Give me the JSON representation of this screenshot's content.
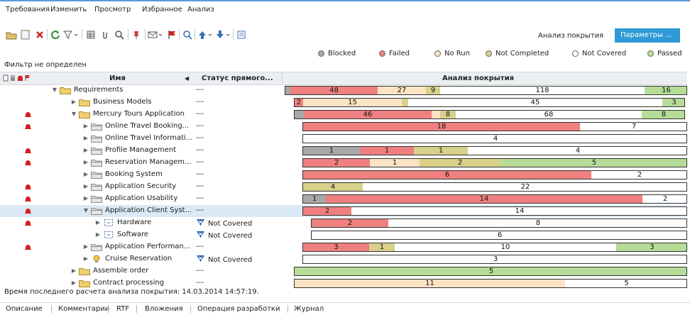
{
  "menu": {
    "items": [
      "Требования",
      "Изменить",
      "Просмотр",
      "Избранное",
      "Анализ"
    ]
  },
  "toolbar": {
    "coverage_label": "Анализ покрытия",
    "params_button": "Параметры ..."
  },
  "legend": [
    {
      "label": "Blocked",
      "color": "#a8a8a8"
    },
    {
      "label": "Failed",
      "color": "#f08080"
    },
    {
      "label": "No Run",
      "color": "#fbe3c4"
    },
    {
      "label": "Not Completed",
      "color": "#d9d08a"
    },
    {
      "label": "Not Covered",
      "color": "#ffffff"
    },
    {
      "label": "Passed",
      "color": "#b7dc98"
    }
  ],
  "filter_text": "Фильтр не определен",
  "columns": {
    "name": "Имя",
    "status": "Статус прямого...",
    "analysis": "Анализ покрытия"
  },
  "rows": [
    {
      "name": "Requirements",
      "status": "---",
      "segs": [
        {
          "s": "blocked",
          "v": ""
        },
        {
          "s": "failed",
          "v": "48"
        },
        {
          "s": "norun",
          "v": "27"
        },
        {
          "s": "notcompleted",
          "v": "9"
        },
        {
          "s": "notcovered",
          "v": "118"
        },
        {
          "s": "passed",
          "v": "16"
        }
      ]
    },
    {
      "name": "Business Models",
      "status": "---",
      "segs": [
        {
          "s": "failed",
          "v": "2"
        },
        {
          "s": "norun",
          "v": "15"
        },
        {
          "s": "notcompleted",
          "v": ""
        },
        {
          "s": "notcovered",
          "v": "45"
        },
        {
          "s": "passed",
          "v": "3"
        }
      ]
    },
    {
      "name": "Mercury Tours Application",
      "status": "---",
      "segs": [
        {
          "s": "blocked",
          "v": ""
        },
        {
          "s": "failed",
          "v": "46"
        },
        {
          "s": "norun",
          "v": ""
        },
        {
          "s": "notcompleted",
          "v": "8"
        },
        {
          "s": "notcovered",
          "v": "68"
        },
        {
          "s": "passed",
          "v": "8"
        }
      ]
    },
    {
      "name": "Online Travel Booking...",
      "status": "---",
      "segs": [
        {
          "s": "failed",
          "v": "18"
        },
        {
          "s": "notcovered",
          "v": "7"
        }
      ]
    },
    {
      "name": "Online Travel Informati...",
      "status": "---",
      "segs": [
        {
          "s": "notcovered",
          "v": "4"
        }
      ]
    },
    {
      "name": "Profile Management",
      "status": "---",
      "segs": [
        {
          "s": "blocked",
          "v": "1"
        },
        {
          "s": "failed",
          "v": "1"
        },
        {
          "s": "notcompleted",
          "v": "1"
        },
        {
          "s": "notcovered",
          "v": "4"
        }
      ]
    },
    {
      "name": "Reservation Managem...",
      "status": "---",
      "segs": [
        {
          "s": "failed",
          "v": "2"
        },
        {
          "s": "norun",
          "v": "1"
        },
        {
          "s": "notcompleted",
          "v": "2"
        },
        {
          "s": "passed",
          "v": "5"
        }
      ]
    },
    {
      "name": "Booking System",
      "status": "---",
      "segs": [
        {
          "s": "failed",
          "v": "6"
        },
        {
          "s": "notcovered",
          "v": "2"
        }
      ]
    },
    {
      "name": "Application Security",
      "status": "---",
      "segs": [
        {
          "s": "notcompleted",
          "v": "4"
        },
        {
          "s": "notcovered",
          "v": "22"
        }
      ]
    },
    {
      "name": "Application Usability",
      "status": "---",
      "segs": [
        {
          "s": "blocked",
          "v": "1"
        },
        {
          "s": "failed",
          "v": "14"
        },
        {
          "s": "notcovered",
          "v": "2"
        }
      ]
    },
    {
      "name": "Application Client Syst...",
      "status": "---",
      "segs": [
        {
          "s": "failed",
          "v": "2"
        },
        {
          "s": "notcovered",
          "v": "14"
        }
      ]
    },
    {
      "name": "Hardware",
      "status": "Not Covered",
      "segs": [
        {
          "s": "failed",
          "v": "2"
        },
        {
          "s": "notcovered",
          "v": "8"
        }
      ]
    },
    {
      "name": "Software",
      "status": "Not Covered",
      "segs": [
        {
          "s": "notcovered",
          "v": "6"
        }
      ]
    },
    {
      "name": "Application Performan...",
      "status": "---",
      "segs": [
        {
          "s": "failed",
          "v": "3"
        },
        {
          "s": "notcompleted",
          "v": "1"
        },
        {
          "s": "notcovered",
          "v": "10"
        },
        {
          "s": "passed",
          "v": "3"
        }
      ]
    },
    {
      "name": "Cruise Reservation",
      "status": "Not Covered",
      "segs": [
        {
          "s": "notcovered",
          "v": "3"
        }
      ]
    },
    {
      "name": "Assemble order",
      "status": "---",
      "segs": [
        {
          "s": "passed",
          "v": "5"
        }
      ]
    },
    {
      "name": "Contract processing",
      "status": "---",
      "segs": [
        {
          "s": "norun",
          "v": "11"
        },
        {
          "s": "notcovered",
          "v": "5"
        }
      ]
    }
  ],
  "footer_note": "Время последнего расчета анализа покрытия: 14.03.2014 14:57:19.",
  "bottom_tabs": [
    "Описание",
    "Комментарии",
    "RTF",
    "Вложения",
    "Операция разработки",
    "Журнал"
  ]
}
